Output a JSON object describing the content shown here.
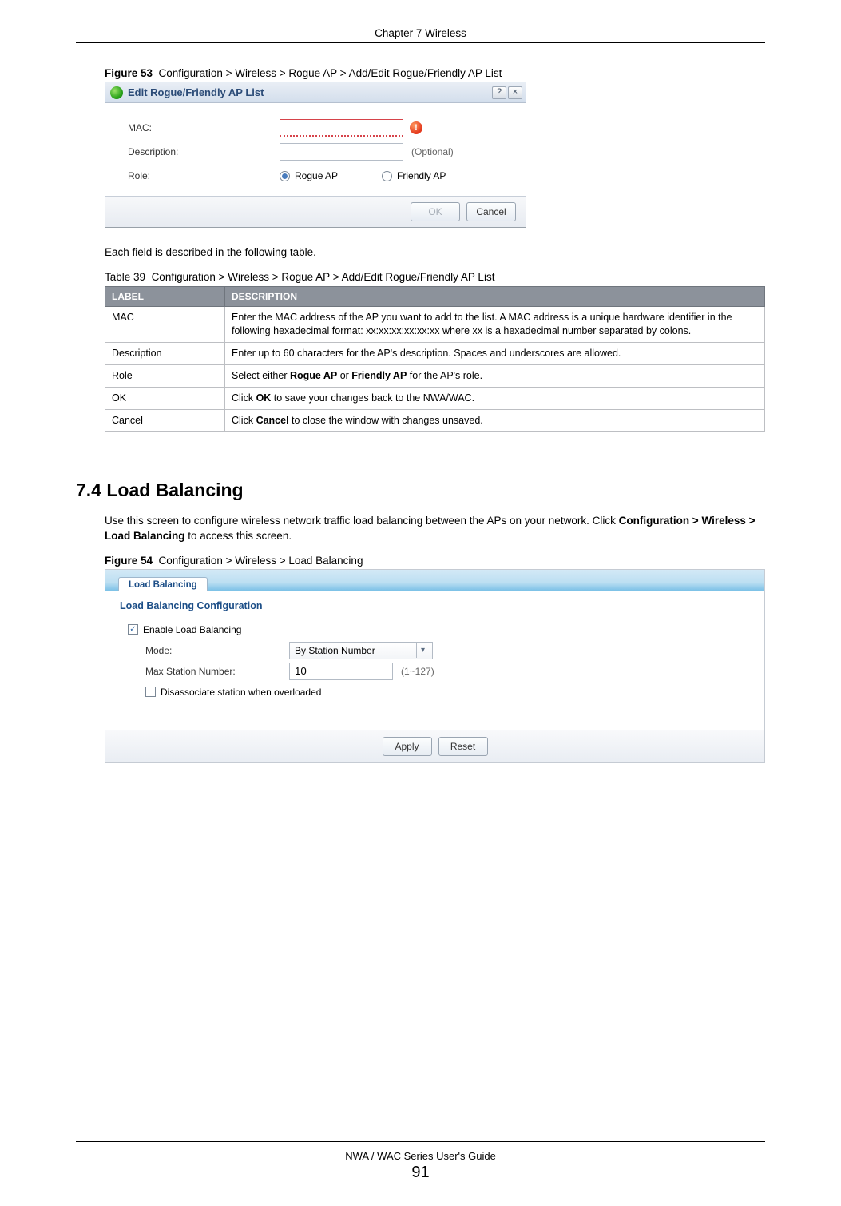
{
  "header": {
    "chapter": "Chapter 7 Wireless"
  },
  "figure53": {
    "label": "Figure 53",
    "caption": "Configuration > Wireless > Rogue AP > Add/Edit Rogue/Friendly AP List",
    "dialog": {
      "title": "Edit Rogue/Friendly AP List",
      "mac_label": "MAC:",
      "mac_value": "",
      "desc_label": "Description:",
      "desc_value": "",
      "optional": "(Optional)",
      "role_label": "Role:",
      "role_rogue": "Rogue AP",
      "role_friendly": "Friendly AP",
      "ok": "OK",
      "cancel": "Cancel",
      "help_icon": "?",
      "close_icon": "×",
      "warn_icon": "!"
    }
  },
  "intro_table": "Each field is described in the following table.",
  "table39": {
    "caption_label": "Table 39",
    "caption_text": "Configuration > Wireless > Rogue AP > Add/Edit Rogue/Friendly AP List",
    "headers": {
      "label": "LABEL",
      "description": "DESCRIPTION"
    },
    "rows": [
      {
        "label": "MAC",
        "desc": "Enter the MAC address of the AP you want to add to the list. A MAC address is a unique hardware identifier in the following hexadecimal format: xx:xx:xx:xx:xx:xx where xx is a hexadecimal number separated by colons."
      },
      {
        "label": "Description",
        "desc": "Enter up to 60 characters for the AP's description. Spaces and underscores are allowed."
      },
      {
        "label": "Role",
        "desc_pre": "Select either ",
        "desc_b1": "Rogue AP",
        "desc_mid": " or ",
        "desc_b2": "Friendly AP",
        "desc_post": " for the AP's role."
      },
      {
        "label": "OK",
        "desc_pre": "Click ",
        "desc_b1": "OK",
        "desc_post": " to save your changes back to the NWA/WAC."
      },
      {
        "label": "Cancel",
        "desc_pre": "Click ",
        "desc_b1": "Cancel",
        "desc_post": " to close the window with changes unsaved."
      }
    ]
  },
  "section74": {
    "heading": "7.4  Load Balancing",
    "para_pre": "Use this screen to configure wireless network traffic load balancing between the APs on your network. Click ",
    "para_bold": "Configuration > Wireless > Load Balancing",
    "para_post": " to access this screen."
  },
  "figure54": {
    "label": "Figure 54",
    "caption": "Configuration > Wireless > Load Balancing",
    "panel": {
      "tab": "Load Balancing",
      "section": "Load Balancing Configuration",
      "enable": "Enable Load Balancing",
      "mode_label": "Mode:",
      "mode_value": "By Station Number",
      "max_label": "Max Station Number:",
      "max_value": "10",
      "max_hint": "(1~127)",
      "disassoc": "Disassociate station when overloaded",
      "apply": "Apply",
      "reset": "Reset"
    }
  },
  "footer": {
    "guide": "NWA / WAC Series User's Guide",
    "page": "91"
  }
}
